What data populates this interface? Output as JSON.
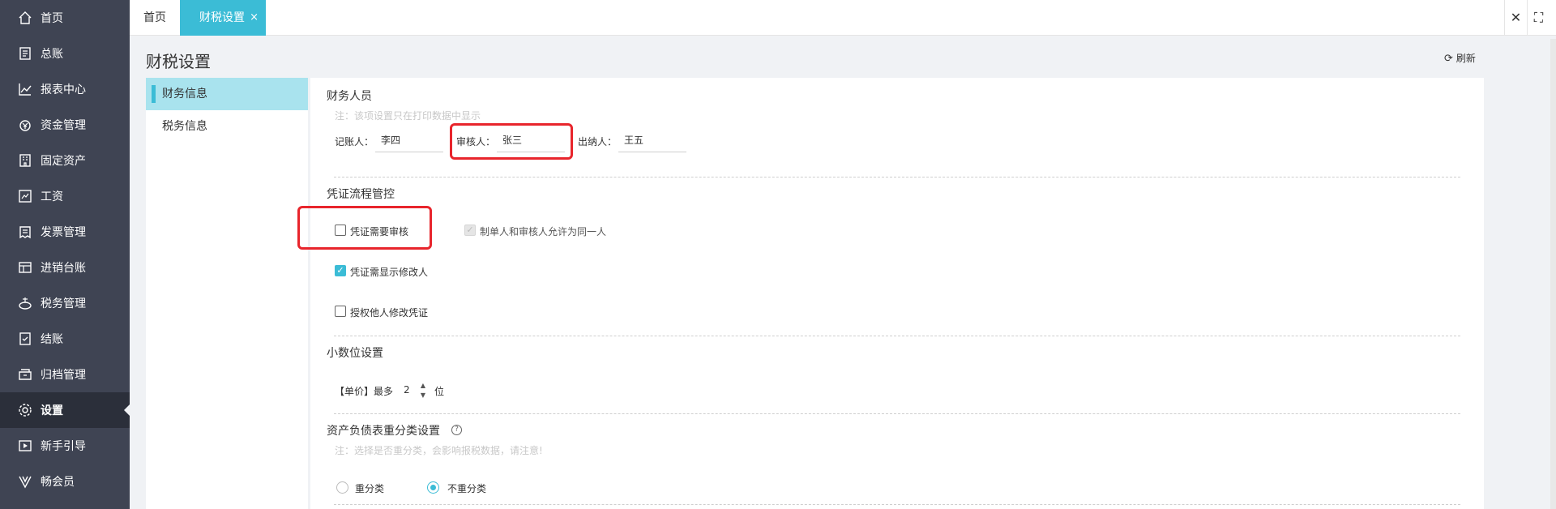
{
  "sidebar": {
    "items": [
      {
        "label": "首页",
        "icon": "home-icon"
      },
      {
        "label": "总账",
        "icon": "ledger-icon"
      },
      {
        "label": "报表中心",
        "icon": "chart-icon"
      },
      {
        "label": "资金管理",
        "icon": "money-icon"
      },
      {
        "label": "固定资产",
        "icon": "building-icon"
      },
      {
        "label": "工资",
        "icon": "salary-icon"
      },
      {
        "label": "发票管理",
        "icon": "invoice-icon"
      },
      {
        "label": "进销台账",
        "icon": "inventory-icon"
      },
      {
        "label": "税务管理",
        "icon": "tax-icon"
      },
      {
        "label": "结账",
        "icon": "checkout-icon"
      },
      {
        "label": "归档管理",
        "icon": "archive-icon"
      },
      {
        "label": "设置",
        "icon": "gear-icon"
      },
      {
        "label": "新手引导",
        "icon": "guide-icon"
      },
      {
        "label": "畅会员",
        "icon": "vip-icon"
      }
    ],
    "active_index": 11
  },
  "tabs": {
    "home": "首页",
    "active": "财税设置",
    "close_symbol": "×"
  },
  "header": {
    "title": "财税设置",
    "refresh_label": "刷新"
  },
  "subnav": {
    "items": [
      "财务信息",
      "税务信息"
    ]
  },
  "finance_staff": {
    "title": "财务人员",
    "note": "注：该项设置只在打印数据中显示",
    "bookkeeper_label": "记账人：",
    "bookkeeper_value": "李四",
    "reviewer_label": "审核人：",
    "reviewer_value": "张三",
    "cashier_label": "出纳人：",
    "cashier_value": "王五"
  },
  "voucher_flow": {
    "title": "凭证流程管控",
    "require_review": {
      "label": "凭证需要审核",
      "checked": false
    },
    "same_person": {
      "label": "制单人和审核人允许为同一人",
      "checked": true,
      "disabled": true
    },
    "show_modifier": {
      "label": "凭证需显示修改人",
      "checked": true
    },
    "authorize_edit": {
      "label": "授权他人修改凭证",
      "checked": false
    }
  },
  "decimal": {
    "title": "小数位设置",
    "prefix": "【单价】最多",
    "value": "2",
    "suffix": "位"
  },
  "reclass": {
    "title": "资产负债表重分类设置",
    "help_symbol": "?",
    "note": "注：选择是否重分类，会影响报税数据，请注意!",
    "option_yes": "重分类",
    "option_no": "不重分类",
    "selected": "不重分类"
  },
  "colors": {
    "accent": "#3bbcd6",
    "sidebar_bg": "#3f4453",
    "highlight_red": "#e8252c"
  }
}
